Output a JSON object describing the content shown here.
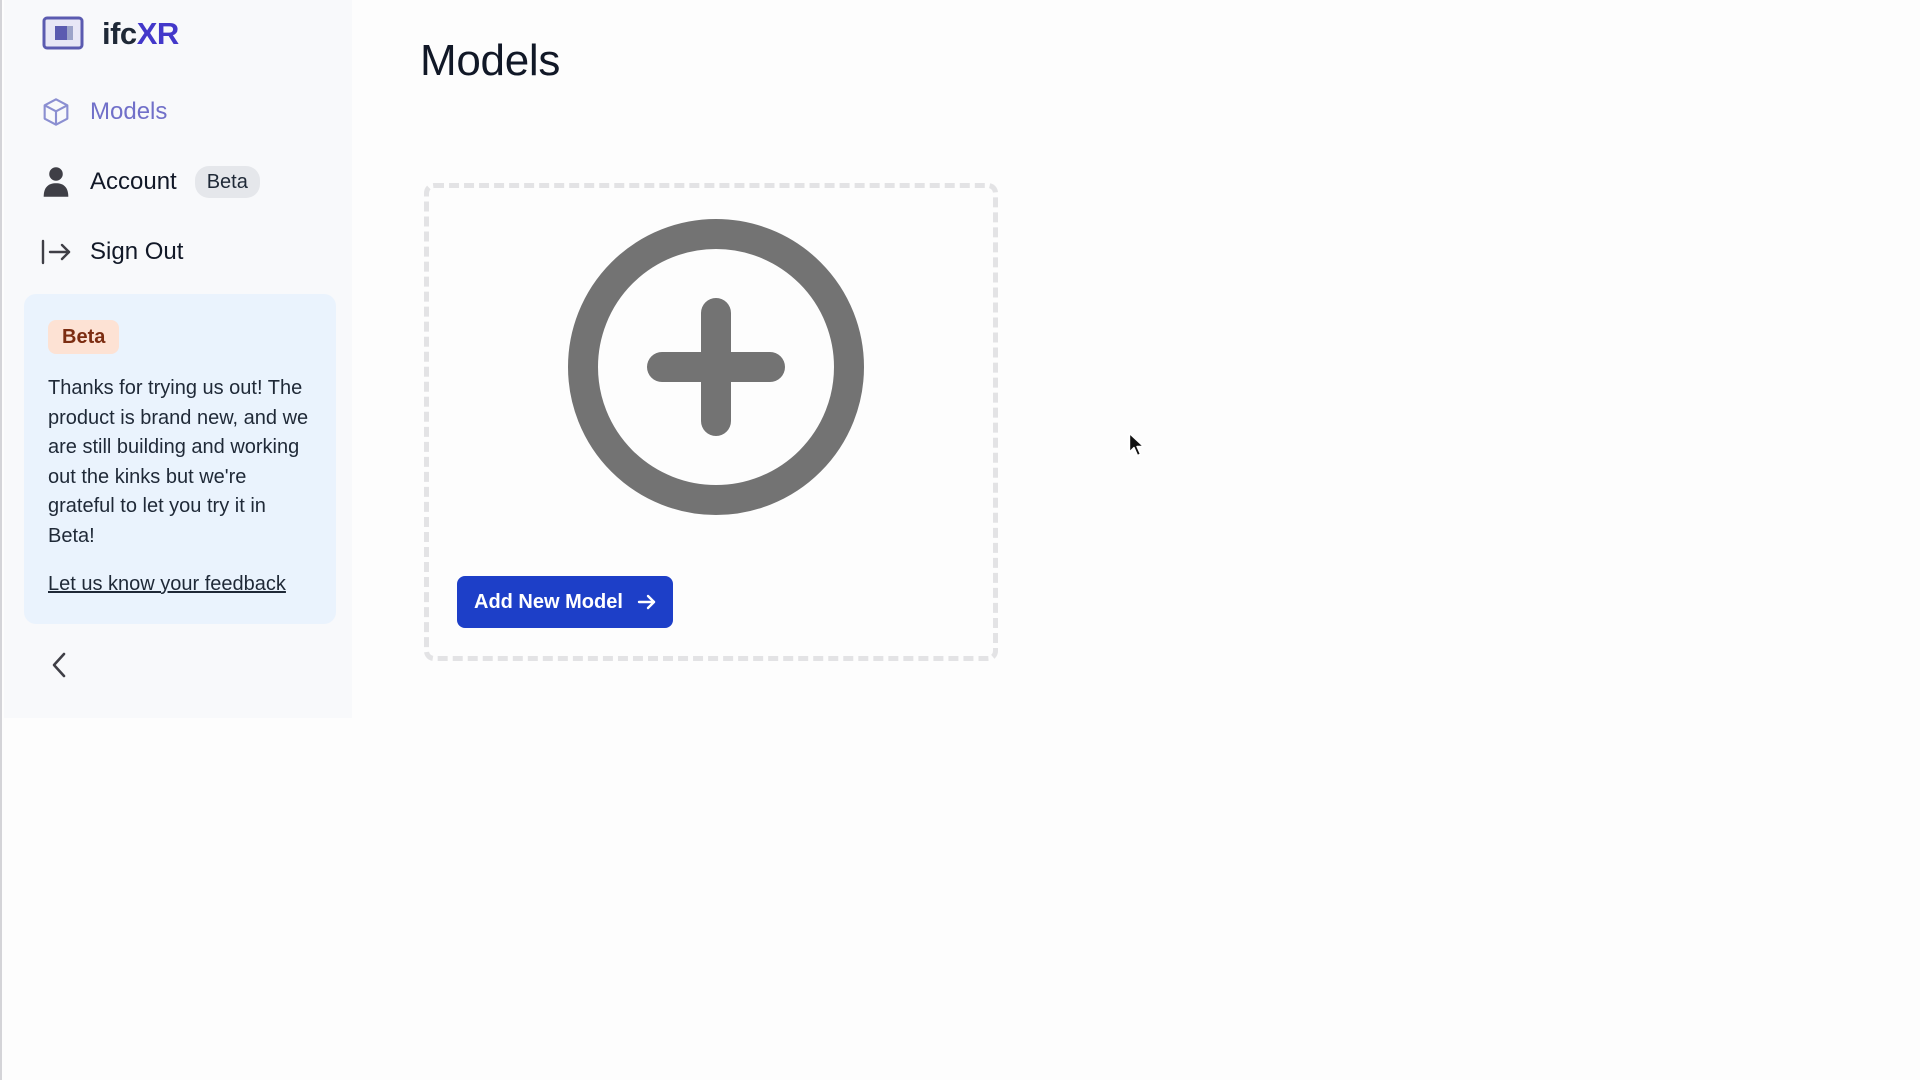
{
  "brand": {
    "name_prefix": "ifc",
    "name_suffix": "XR",
    "accent": "#4338ca"
  },
  "sidebar": {
    "items": [
      {
        "label": "Models",
        "icon": "cube-icon",
        "active": true
      },
      {
        "label": "Account",
        "icon": "user-icon",
        "badge": "Beta"
      },
      {
        "label": "Sign Out",
        "icon": "sign-out-icon"
      }
    ],
    "beta_card": {
      "pill": "Beta",
      "message": "Thanks for trying us out! The product is brand new, and we are still building and working out the kinks but we're grateful to let you try it in Beta!",
      "link": "Let us know your feedback"
    },
    "collapse_icon": "chevron-left-icon"
  },
  "main": {
    "title": "Models",
    "add_card": {
      "icon": "plus-circle-icon",
      "button_label": "Add New Model",
      "button_color": "#1d3fc8"
    }
  }
}
